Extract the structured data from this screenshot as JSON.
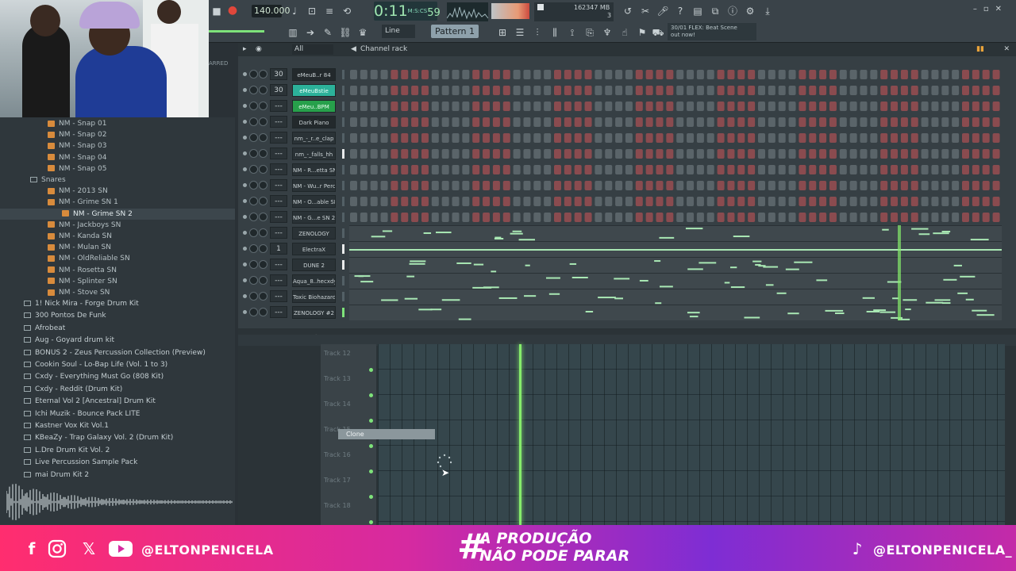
{
  "toolbar": {
    "tempo": "140.000",
    "time": "0:11",
    "time_frac": "59",
    "time_unit": "M:S:CS",
    "cpu_polyphony": "16",
    "cpu_memory": "2347 MB",
    "cpu_voices": "3",
    "snap_mode": "Line",
    "pattern": "Pattern 1",
    "hint_line1": "30/01  FLEX: Beat Scene",
    "hint_line2": "out now!"
  },
  "browser": {
    "filter": "All",
    "header": "ARRED",
    "items": [
      {
        "label": "NM - Snap 01",
        "type": "file"
      },
      {
        "label": "NM - Snap 02",
        "type": "file"
      },
      {
        "label": "NM - Snap 03",
        "type": "file"
      },
      {
        "label": "NM - Snap 04",
        "type": "file"
      },
      {
        "label": "NM - Snap 05",
        "type": "file"
      },
      {
        "label": "Snares",
        "type": "folder"
      },
      {
        "label": "NM - 2013 SN",
        "type": "file"
      },
      {
        "label": "NM - Grime SN 1",
        "type": "file"
      },
      {
        "label": "NM - Grime SN 2",
        "type": "file",
        "selected": true
      },
      {
        "label": "NM - Jackboys SN",
        "type": "file"
      },
      {
        "label": "NM - Kanda SN",
        "type": "file"
      },
      {
        "label": "NM - Mulan SN",
        "type": "file"
      },
      {
        "label": "NM - OldReliable SN",
        "type": "file"
      },
      {
        "label": "NM - Rosetta SN",
        "type": "file"
      },
      {
        "label": "NM - Splinter SN",
        "type": "file"
      },
      {
        "label": "NM - Stove SN",
        "type": "file"
      }
    ],
    "folders": [
      "1! Nick Mira - Forge Drum Kit",
      "300 Pontos De Funk",
      "Afrobeat",
      "Aug - Goyard drum kit",
      "BONUS 2 - Zeus Percussion Collection (Preview)",
      "Cookin Soul - Lo-Bap Life (Vol. 1 to 3)",
      "Cxdy - Everything Must Go (808 Kit)",
      "Cxdy - Reddit (Drum Kit)",
      "Eternal Vol 2 [Ancestral] Drum Kit",
      "Ichi Muzik - Bounce Pack  LITE",
      "Kastner Vox Kit Vol.1",
      "KBeaZy - Trap Galaxy Vol. 2 (Drum Kit)",
      "L.Dre Drum Kit Vol. 2",
      "Live Percussion Sample Pack",
      "mai Drum Kit 2"
    ]
  },
  "rack": {
    "title": "Channel rack",
    "filter": "All",
    "channels": [
      {
        "num": "30",
        "name": "eMeuB..r 84",
        "style": "dark",
        "kind": "steps"
      },
      {
        "num": "30",
        "name": "eMeuBstie",
        "style": "green",
        "kind": "steps"
      },
      {
        "num": "---",
        "name": "eMeu..BPM",
        "style": "green2",
        "kind": "steps"
      },
      {
        "num": "---",
        "name": "Dark Piano",
        "style": "dark",
        "kind": "steps"
      },
      {
        "num": "---",
        "name": "nm_-_r..e_clap",
        "style": "normal",
        "kind": "steps"
      },
      {
        "num": "---",
        "name": "nm_-_falls_hh",
        "style": "normal",
        "kind": "steps"
      },
      {
        "num": "---",
        "name": "NM - R...etta SN",
        "style": "normal",
        "kind": "steps"
      },
      {
        "num": "---",
        "name": "NM - Wu..r Perc",
        "style": "normal",
        "kind": "steps"
      },
      {
        "num": "---",
        "name": "NM - O...able SN",
        "style": "normal",
        "kind": "steps"
      },
      {
        "num": "---",
        "name": "NM - G...e SN 2",
        "style": "normal",
        "kind": "steps"
      },
      {
        "num": "---",
        "name": "ZENOLOGY",
        "style": "normal",
        "kind": "piano"
      },
      {
        "num": "1",
        "name": "ElectraX",
        "style": "normal",
        "kind": "piano"
      },
      {
        "num": "---",
        "name": "DUNE 2",
        "style": "normal",
        "kind": "piano"
      },
      {
        "num": "---",
        "name": "Aqua_8..hecxdy",
        "style": "normal",
        "kind": "piano"
      },
      {
        "num": "---",
        "name": "Toxic Biohazard",
        "style": "normal",
        "kind": "piano"
      },
      {
        "num": "---",
        "name": "ZENOLOGY #2",
        "style": "normal",
        "kind": "piano"
      }
    ]
  },
  "playlist": {
    "tracks": [
      "Track 12",
      "Track 13",
      "Track 14",
      "Track 15",
      "Track 16",
      "Track 17",
      "Track 18"
    ],
    "context_menu_item": "Clone"
  },
  "footer": {
    "handle_left": "@ELTONPENICELA",
    "slogan_hash": "#",
    "slogan_line1": "A PRODUÇÃO",
    "slogan_line2": "NÃO PODE PARAR",
    "handle_right": "@ELTONPENICELA_"
  },
  "colors": {
    "accent_green": "#86ec6b",
    "footer_pink": "#ff2d6f",
    "footer_purple": "#7e2dd4",
    "step_red": "#8a4b4f",
    "step_gray": "#5a6469"
  }
}
